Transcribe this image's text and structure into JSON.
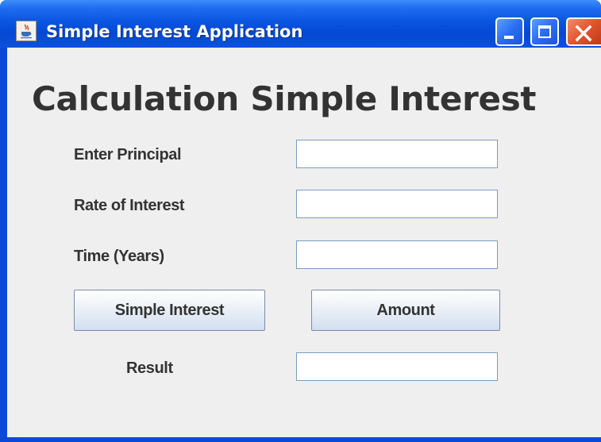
{
  "window": {
    "title": "Simple Interest Application",
    "icon": "java-cup-icon",
    "controls": [
      "minimize-icon",
      "maximize-icon",
      "close-icon"
    ]
  },
  "form": {
    "heading": "Calculation Simple Interest",
    "principal_label": "Enter Principal",
    "principal_value": "",
    "rate_label": "Rate of Interest",
    "rate_value": "",
    "time_label": "Time (Years)",
    "time_value": "",
    "simple_interest_button": "Simple Interest",
    "amount_button": "Amount",
    "result_label": "Result",
    "result_value": ""
  },
  "colors": {
    "titlebar": "#0a55e0",
    "panel_background": "#efefef",
    "close_button": "#e2542e"
  }
}
